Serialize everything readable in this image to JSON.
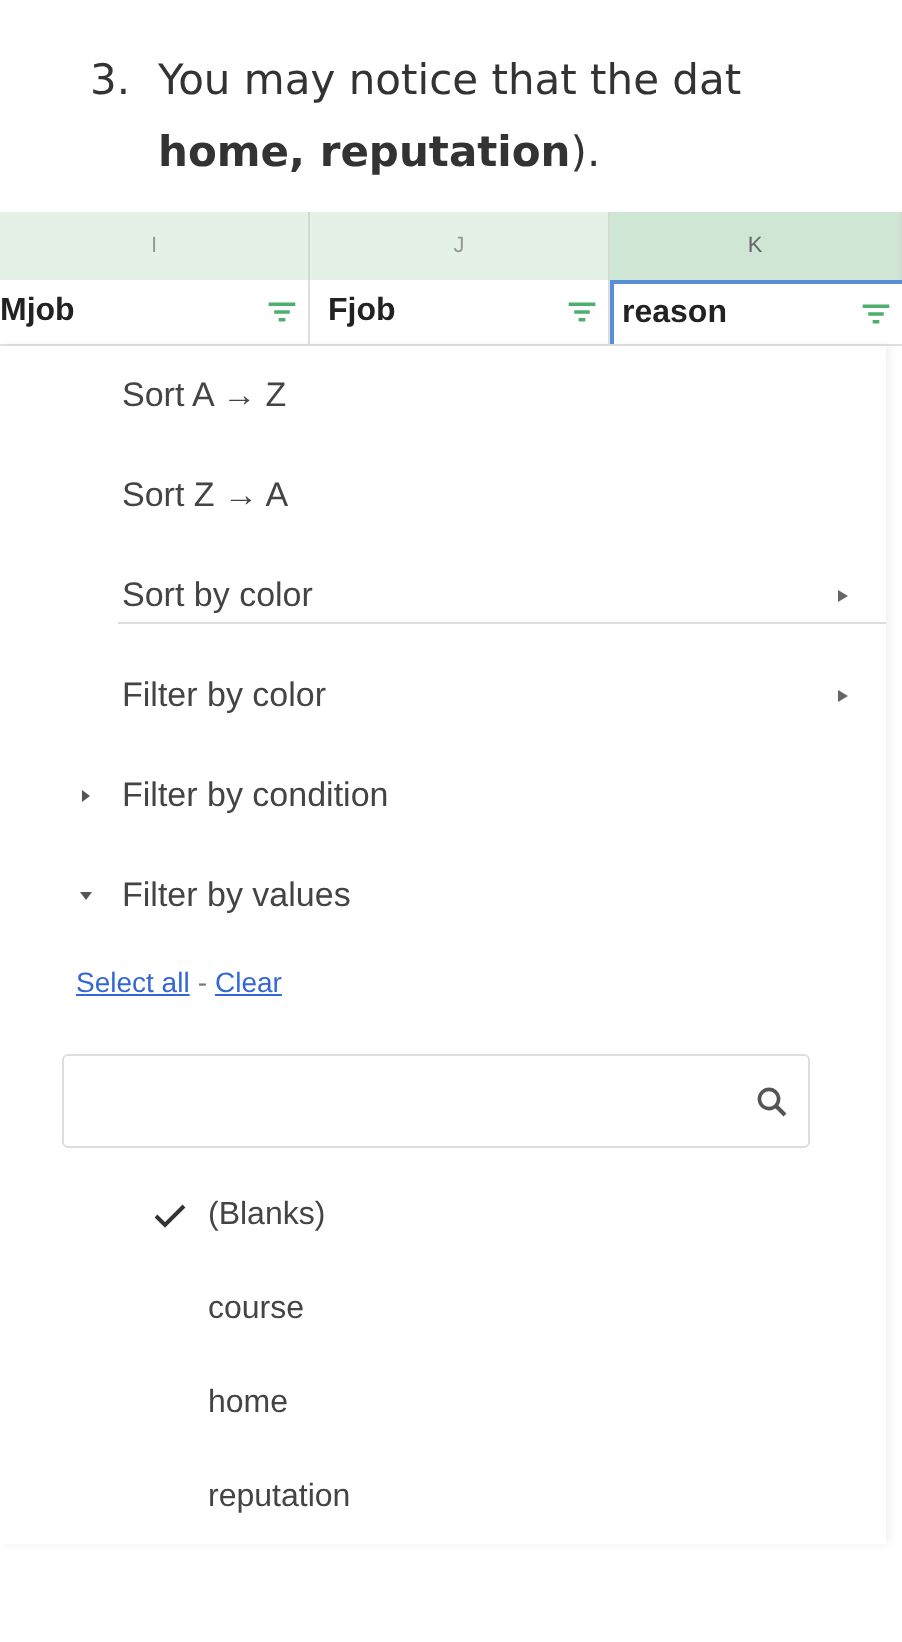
{
  "instruction": {
    "number": "3.",
    "lines": [
      "You may notice that the dat",
      "**home, reputation**)."
    ]
  },
  "columns": [
    {
      "letter": "I",
      "header": "Mjob",
      "selected": false
    },
    {
      "letter": "J",
      "header": "Fjob",
      "selected": false
    },
    {
      "letter": "K",
      "header": "reason",
      "selected": true
    }
  ],
  "menu": {
    "sort_items": [
      {
        "label": "Sort A → Z",
        "kind": "plain"
      },
      {
        "label": "Sort Z → A",
        "kind": "plain"
      },
      {
        "label": "Sort by color",
        "kind": "submenu"
      }
    ],
    "filter_items": [
      {
        "label": "Filter by color",
        "kind": "submenu"
      },
      {
        "label": "Filter by condition",
        "kind": "section",
        "expanded": false
      },
      {
        "label": "Filter by values",
        "kind": "section",
        "expanded": true
      }
    ],
    "select_all": "Select all",
    "separator": "-",
    "clear": "Clear",
    "values": [
      {
        "label": "(Blanks)",
        "checked": true
      },
      {
        "label": "course",
        "checked": false
      },
      {
        "label": "home",
        "checked": false
      },
      {
        "label": "reputation",
        "checked": false
      }
    ]
  }
}
